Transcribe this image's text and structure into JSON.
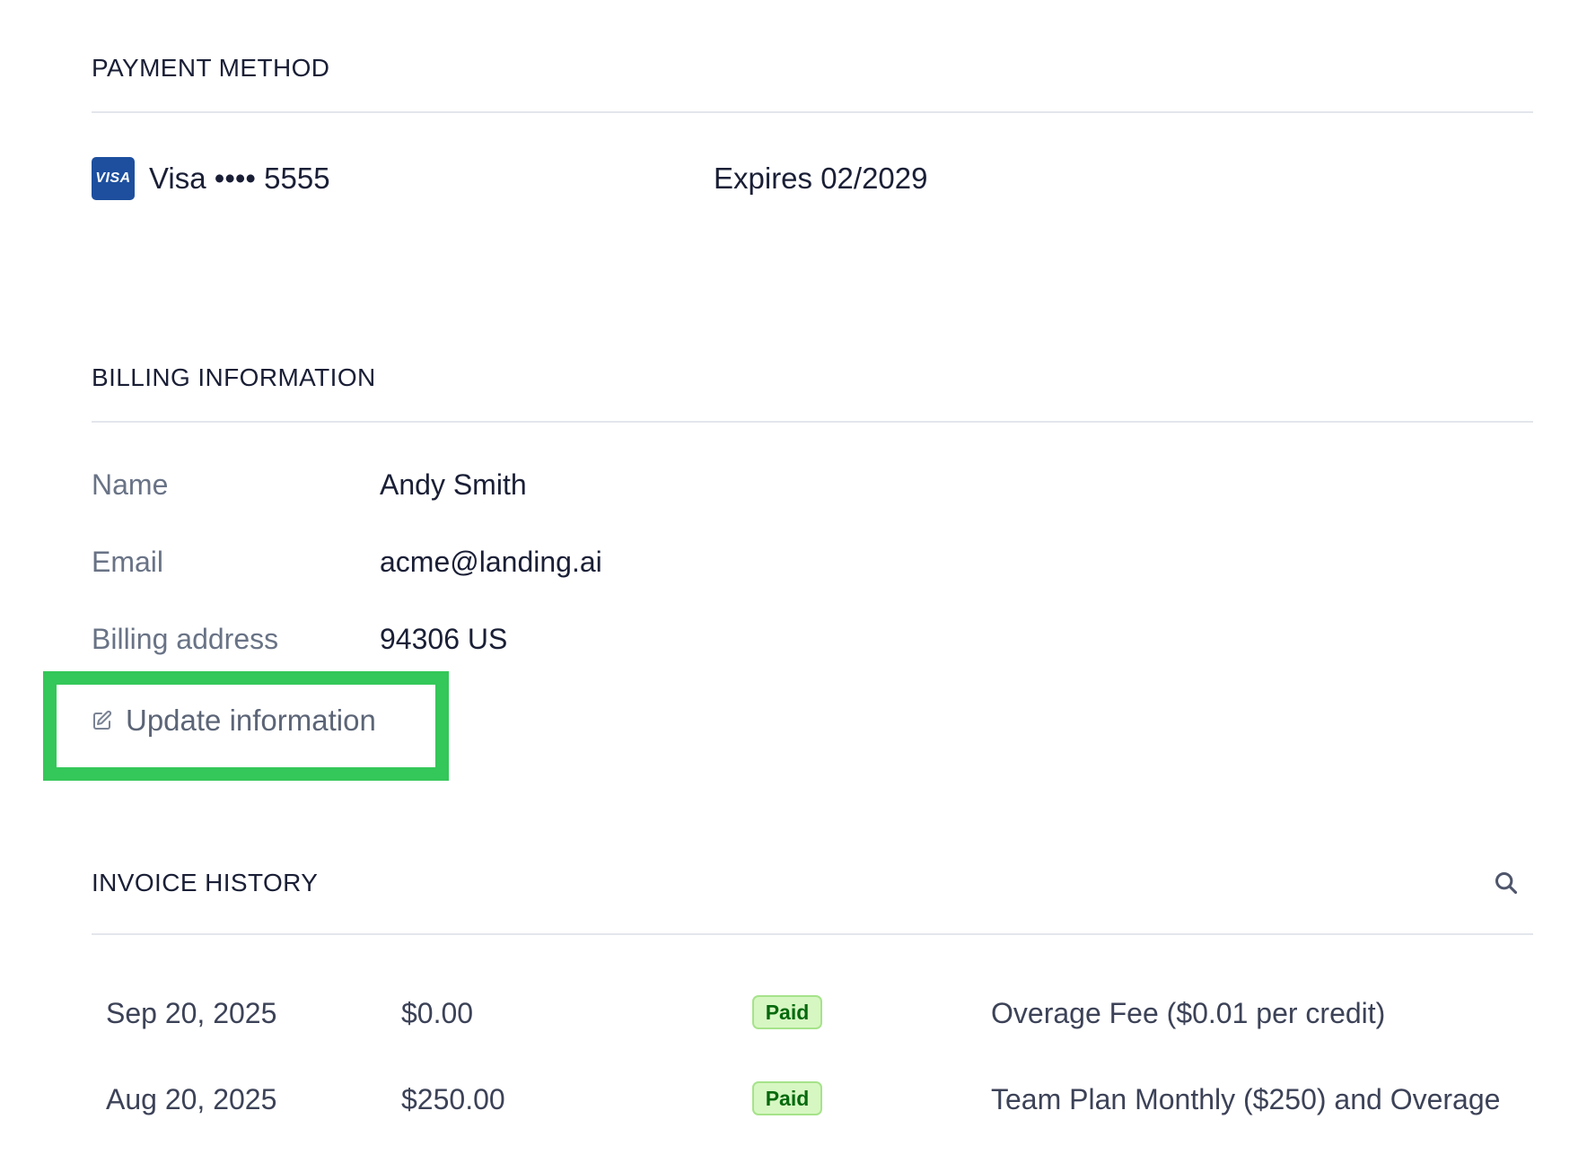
{
  "payment_method": {
    "title": "PAYMENT METHOD",
    "card_brand_badge": "VISA",
    "card_label": "Visa •••• 5555",
    "expiry": "Expires 02/2029",
    "brand_color": "#1d4f9e"
  },
  "billing_information": {
    "title": "BILLING INFORMATION",
    "fields": [
      {
        "label": "Name",
        "value": "Andy Smith"
      },
      {
        "label": "Email",
        "value": "acme@landing.ai"
      },
      {
        "label": "Billing address",
        "value": "94306 US"
      }
    ],
    "update_button_label": "Update information",
    "edit_icon": "edit-icon",
    "highlight_color": "#34c759"
  },
  "invoice_history": {
    "title": "INVOICE HISTORY",
    "search_icon": "search-icon",
    "rows": [
      {
        "date": "Sep 20, 2025",
        "amount": "$0.00",
        "status": "Paid",
        "description": "Overage Fee ($0.01 per credit)"
      },
      {
        "date": "Aug 20, 2025",
        "amount": "$250.00",
        "status": "Paid",
        "description": "Team Plan Monthly ($250) and Overage"
      }
    ],
    "status_colors": {
      "bg": "#d7f7c2",
      "border": "#a6e38a",
      "text": "#05690d"
    }
  }
}
